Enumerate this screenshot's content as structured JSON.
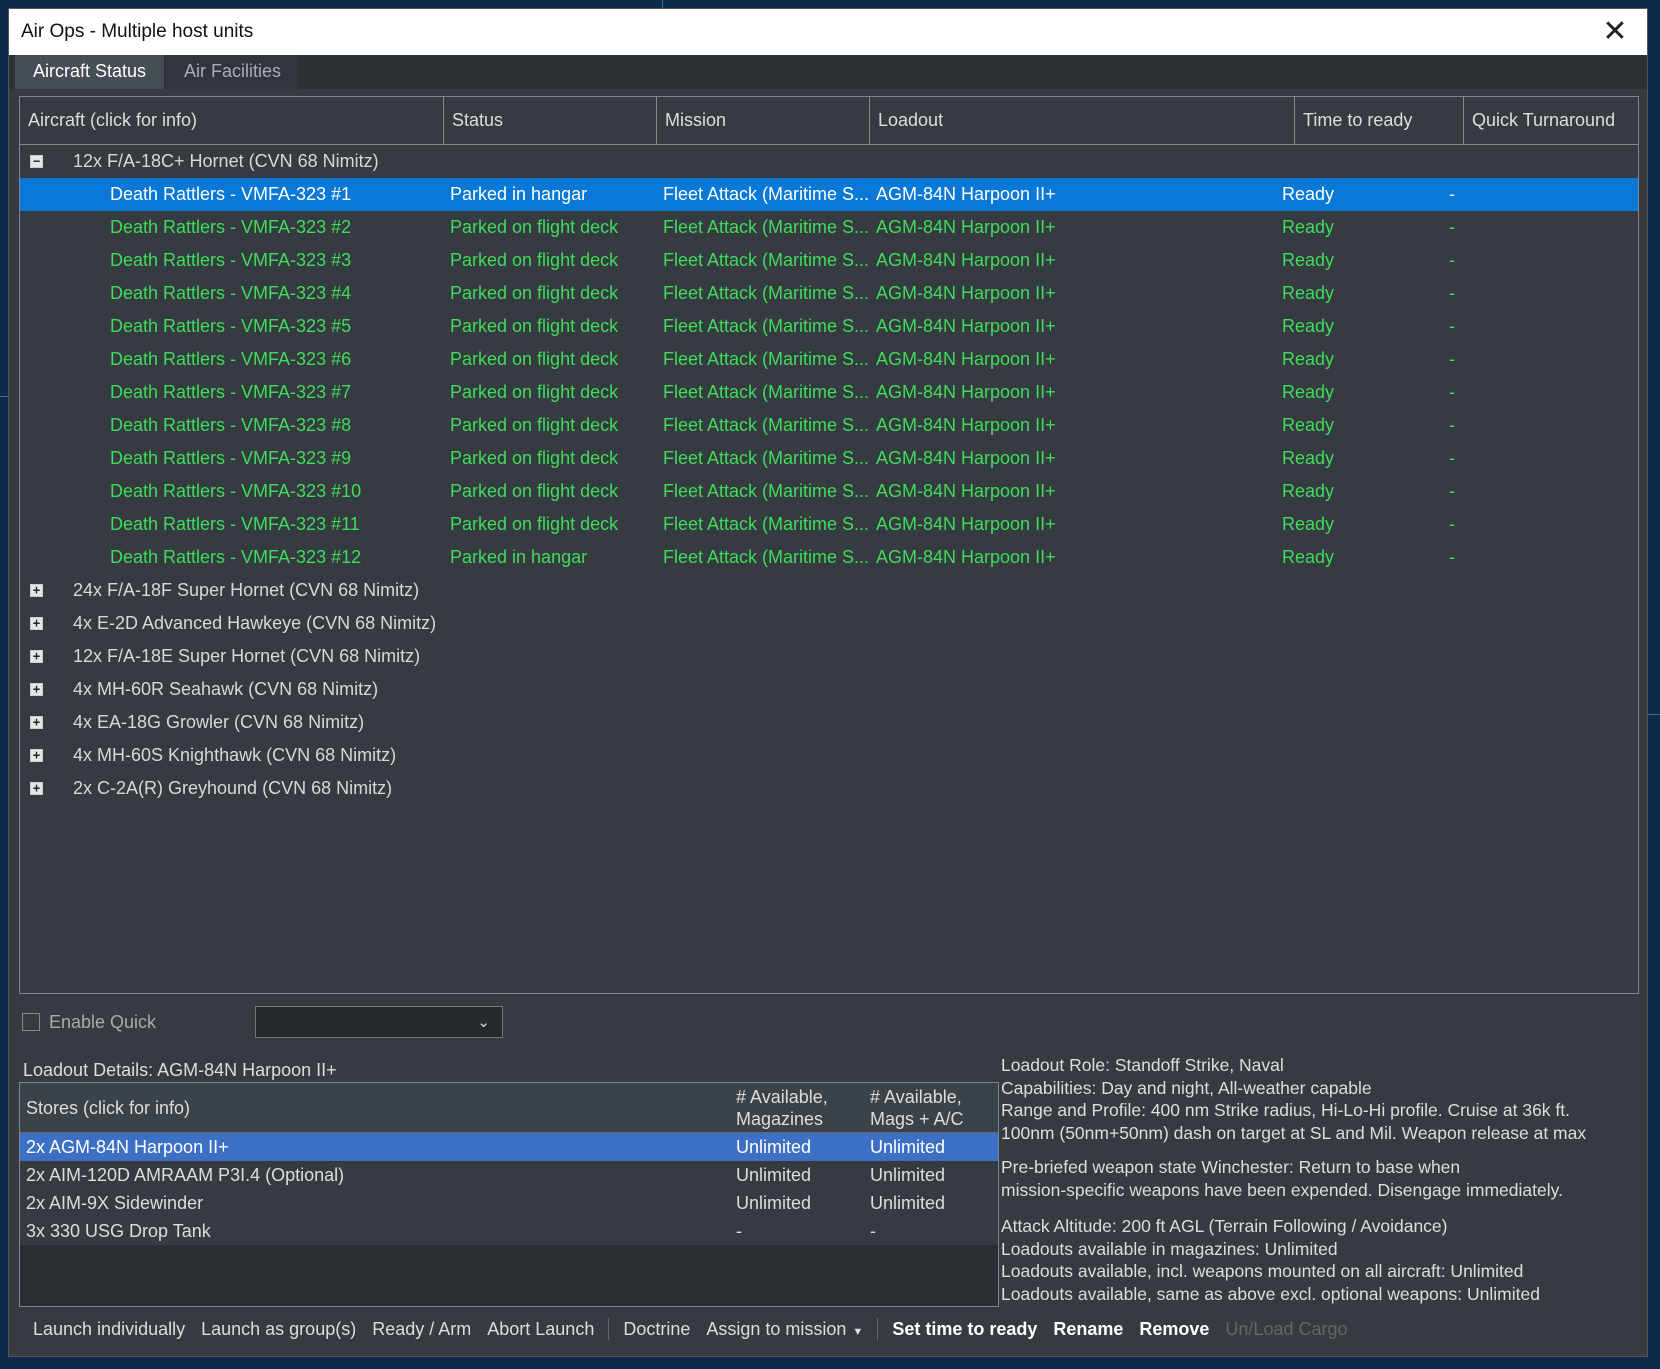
{
  "window": {
    "title": "Air Ops - Multiple host units",
    "close_glyph": "✕"
  },
  "tabs": [
    {
      "label": "Aircraft Status"
    },
    {
      "label": "Air Facilities"
    }
  ],
  "grid": {
    "columns": [
      "Aircraft (click for info)",
      "Status",
      "Mission",
      "Loadout",
      "Time to ready",
      "Quick Turnaround"
    ],
    "group1": {
      "toggle": "−",
      "label": "12x F/A-18C+ Hornet (CVN 68 Nimitz)"
    },
    "rows": [
      {
        "aircraft": "Death Rattlers - VMFA-323 #1",
        "status": "Parked in hangar",
        "mission": "Fleet Attack (Maritime S...",
        "loadout": "AGM-84N Harpoon II+",
        "time": "Ready",
        "quick": "-"
      },
      {
        "aircraft": "Death Rattlers - VMFA-323 #2",
        "status": "Parked on flight deck",
        "mission": "Fleet Attack (Maritime S...",
        "loadout": "AGM-84N Harpoon II+",
        "time": "Ready",
        "quick": "-"
      },
      {
        "aircraft": "Death Rattlers - VMFA-323 #3",
        "status": "Parked on flight deck",
        "mission": "Fleet Attack (Maritime S...",
        "loadout": "AGM-84N Harpoon II+",
        "time": "Ready",
        "quick": "-"
      },
      {
        "aircraft": "Death Rattlers - VMFA-323 #4",
        "status": "Parked on flight deck",
        "mission": "Fleet Attack (Maritime S...",
        "loadout": "AGM-84N Harpoon II+",
        "time": "Ready",
        "quick": "-"
      },
      {
        "aircraft": "Death Rattlers - VMFA-323 #5",
        "status": "Parked on flight deck",
        "mission": "Fleet Attack (Maritime S...",
        "loadout": "AGM-84N Harpoon II+",
        "time": "Ready",
        "quick": "-"
      },
      {
        "aircraft": "Death Rattlers - VMFA-323 #6",
        "status": "Parked on flight deck",
        "mission": "Fleet Attack (Maritime S...",
        "loadout": "AGM-84N Harpoon II+",
        "time": "Ready",
        "quick": "-"
      },
      {
        "aircraft": "Death Rattlers - VMFA-323 #7",
        "status": "Parked on flight deck",
        "mission": "Fleet Attack (Maritime S...",
        "loadout": "AGM-84N Harpoon II+",
        "time": "Ready",
        "quick": "-"
      },
      {
        "aircraft": "Death Rattlers - VMFA-323 #8",
        "status": "Parked on flight deck",
        "mission": "Fleet Attack (Maritime S...",
        "loadout": "AGM-84N Harpoon II+",
        "time": "Ready",
        "quick": "-"
      },
      {
        "aircraft": "Death Rattlers - VMFA-323 #9",
        "status": "Parked on flight deck",
        "mission": "Fleet Attack (Maritime S...",
        "loadout": "AGM-84N Harpoon II+",
        "time": "Ready",
        "quick": "-"
      },
      {
        "aircraft": "Death Rattlers - VMFA-323 #10",
        "status": "Parked on flight deck",
        "mission": "Fleet Attack (Maritime S...",
        "loadout": "AGM-84N Harpoon II+",
        "time": "Ready",
        "quick": "-"
      },
      {
        "aircraft": "Death Rattlers - VMFA-323 #11",
        "status": "Parked on flight deck",
        "mission": "Fleet Attack (Maritime S...",
        "loadout": "AGM-84N Harpoon II+",
        "time": "Ready",
        "quick": "-"
      },
      {
        "aircraft": "Death Rattlers - VMFA-323 #12",
        "status": "Parked in hangar",
        "mission": "Fleet Attack (Maritime S...",
        "loadout": "AGM-84N Harpoon II+",
        "time": "Ready",
        "quick": "-"
      }
    ],
    "groups": [
      {
        "toggle": "+",
        "label": "24x F/A-18F Super Hornet (CVN 68 Nimitz)"
      },
      {
        "toggle": "+",
        "label": "4x E-2D Advanced Hawkeye (CVN 68 Nimitz)"
      },
      {
        "toggle": "+",
        "label": "12x F/A-18E Super Hornet (CVN 68 Nimitz)"
      },
      {
        "toggle": "+",
        "label": "4x MH-60R Seahawk (CVN 68 Nimitz)"
      },
      {
        "toggle": "+",
        "label": "4x EA-18G Growler (CVN 68 Nimitz)"
      },
      {
        "toggle": "+",
        "label": "4x MH-60S Knighthawk (CVN 68 Nimitz)"
      },
      {
        "toggle": "+",
        "label": "2x C-2A(R) Greyhound (CVN 68 Nimitz)"
      }
    ]
  },
  "quick": {
    "label": "Enable Quick",
    "chevron": "⌄"
  },
  "loadout": {
    "title": "Loadout Details: AGM-84N Harpoon II+",
    "headers": {
      "stores": "Stores (click for info)",
      "avail_mag_1": "# Available,",
      "avail_mag_2": "Magazines",
      "avail_ac_1": "# Available,",
      "avail_ac_2": "Mags + A/C"
    },
    "stores": [
      {
        "name": "2x AGM-84N Harpoon II+",
        "mag": "Unlimited",
        "ac": "Unlimited"
      },
      {
        "name": "2x AIM-120D AMRAAM P3I.4   (Optional)",
        "mag": "Unlimited",
        "ac": "Unlimited"
      },
      {
        "name": "2x AIM-9X Sidewinder",
        "mag": "Unlimited",
        "ac": "Unlimited"
      },
      {
        "name": "3x 330 USG Drop Tank",
        "mag": "-",
        "ac": "-"
      }
    ]
  },
  "details": {
    "role": "Loadout Role: Standoff Strike, Naval",
    "capabilities": "Capabilities: Day and night, All-weather capable",
    "range_1": "Range and Profile: 400 nm Strike radius, Hi-Lo-Hi profile. Cruise at 36k ft.",
    "range_2": "100nm (50nm+50nm) dash on target at SL and Mil. Weapon release at max",
    "winchester_1": "Pre-briefed weapon state Winchester: Return to base when",
    "winchester_2": "mission-specific weapons have been expended. Disengage immediately.",
    "altitude": "Attack Altitude: 200 ft AGL (Terrain Following / Avoidance)",
    "avail_1": "Loadouts available in magazines: Unlimited",
    "avail_2": "Loadouts available, incl. weapons mounted on all aircraft: Unlimited",
    "avail_3": "Loadouts available, same as above excl. optional weapons: Unlimited"
  },
  "toolbar": {
    "launch_individually": "Launch individually",
    "launch_group": "Launch as group(s)",
    "ready_arm": "Ready / Arm",
    "abort": "Abort Launch",
    "doctrine": "Doctrine",
    "assign": "Assign to mission",
    "caret": "▼",
    "set_time": "Set time to ready",
    "rename": "Rename",
    "remove": "Remove",
    "cargo": "Un/Load Cargo"
  }
}
